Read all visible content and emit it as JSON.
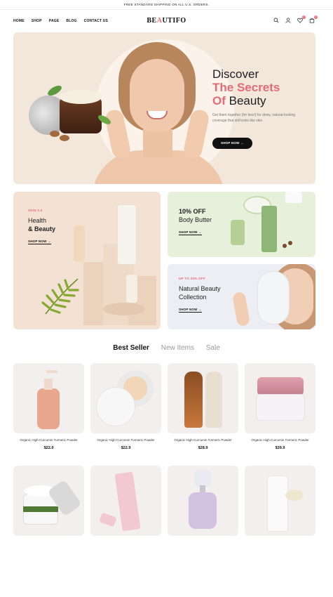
{
  "announcement": "FREE STANDARD SHIPPING ON ALL U.S. ORDERS.",
  "nav": {
    "links": [
      "HOME",
      "SHOP",
      "PAGE",
      "BLOG",
      "CONTACT US"
    ],
    "logo_pre": "BE",
    "logo_accent": "A",
    "logo_post": "UTIFO",
    "wishlist_count": "0",
    "cart_count": "0"
  },
  "hero": {
    "title_line1": "Discover",
    "title_line2": "The Secrets",
    "title_line3_pink": "Of",
    "title_line3_rest": " Beauty",
    "subtitle": "Get them together (for less!) for dewy, natural-looking coverage that still looks like skin",
    "button": "SHOP NOW →"
  },
  "promos": {
    "health": {
      "tag": "SKIN 2.0",
      "line1": "Health",
      "line2": "& Beauty",
      "link": "SHOP NOW →"
    },
    "body_butter": {
      "line1": "10% OFF",
      "line2": "Body Butter",
      "link": "SHOP NOW →"
    },
    "natural": {
      "tag": "UP TO 30% OFF",
      "line1": "Natural Beauty",
      "line2": "Collection",
      "link": "SHOP NOW →"
    }
  },
  "tabs": [
    "Best Seller",
    "New Items",
    "Sale"
  ],
  "products": [
    {
      "name": "Organic High-Curcumin Turmeric Powder",
      "price": "$22.9"
    },
    {
      "name": "Organic High-Curcumin Turmeric Powder",
      "price": "$22.9"
    },
    {
      "name": "Organic High-Curcumin Turmeric Powder",
      "price": "$28.9"
    },
    {
      "name": "Organic High-Curcumin Turmeric Powder",
      "price": "$39.9"
    }
  ],
  "colors": {
    "accent": "#e36b77",
    "dark": "#111111"
  }
}
